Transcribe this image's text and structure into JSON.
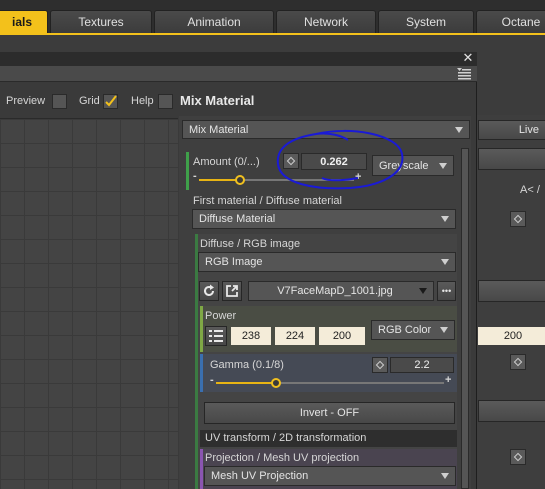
{
  "tabs": [
    {
      "label": "ials",
      "active": true
    },
    {
      "label": "Textures",
      "active": false
    },
    {
      "label": "Animation",
      "active": false
    },
    {
      "label": "Network",
      "active": false
    },
    {
      "label": "System",
      "active": false
    },
    {
      "label": "Octane",
      "active": false
    }
  ],
  "toolbar": {
    "preview_label": "Preview",
    "grid_label": "Grid",
    "grid_checked": true,
    "help_label": "Help",
    "panel_title": "Mix Material"
  },
  "right_panel": {
    "live_label": "Live",
    "a_label": "A< /",
    "value_200": "200"
  },
  "mix_material": {
    "type_dropdown": "Mix Material",
    "amount": {
      "label": "Amount (0/...)",
      "value": "0.262",
      "fraction": 0.262,
      "mode": "Greyscale"
    },
    "first_material_label": "First material / Diffuse material",
    "first_material_value": "Diffuse Material",
    "diffuse_label": "Diffuse / RGB image",
    "diffuse_value": "RGB Image",
    "file_name": "V7FaceMapD_1001.jpg",
    "more_label": "•••",
    "power": {
      "label": "Power",
      "r": "238",
      "g": "224",
      "b": "200",
      "mode": "RGB Color"
    },
    "gamma": {
      "label": "Gamma (0.1/8)",
      "value": "2.2",
      "fraction": 0.265
    },
    "invert_label": "Invert - OFF",
    "uv_transform_label": "UV transform / 2D transformation",
    "projection_label": "Projection / Mesh UV projection",
    "projection_value": "Mesh UV Projection"
  },
  "colors": {
    "active_tab": "#f3c11b",
    "annotation": "#1a1ad6",
    "green_bar": "#3fa04a",
    "blue_bar": "#3a6fb0"
  }
}
